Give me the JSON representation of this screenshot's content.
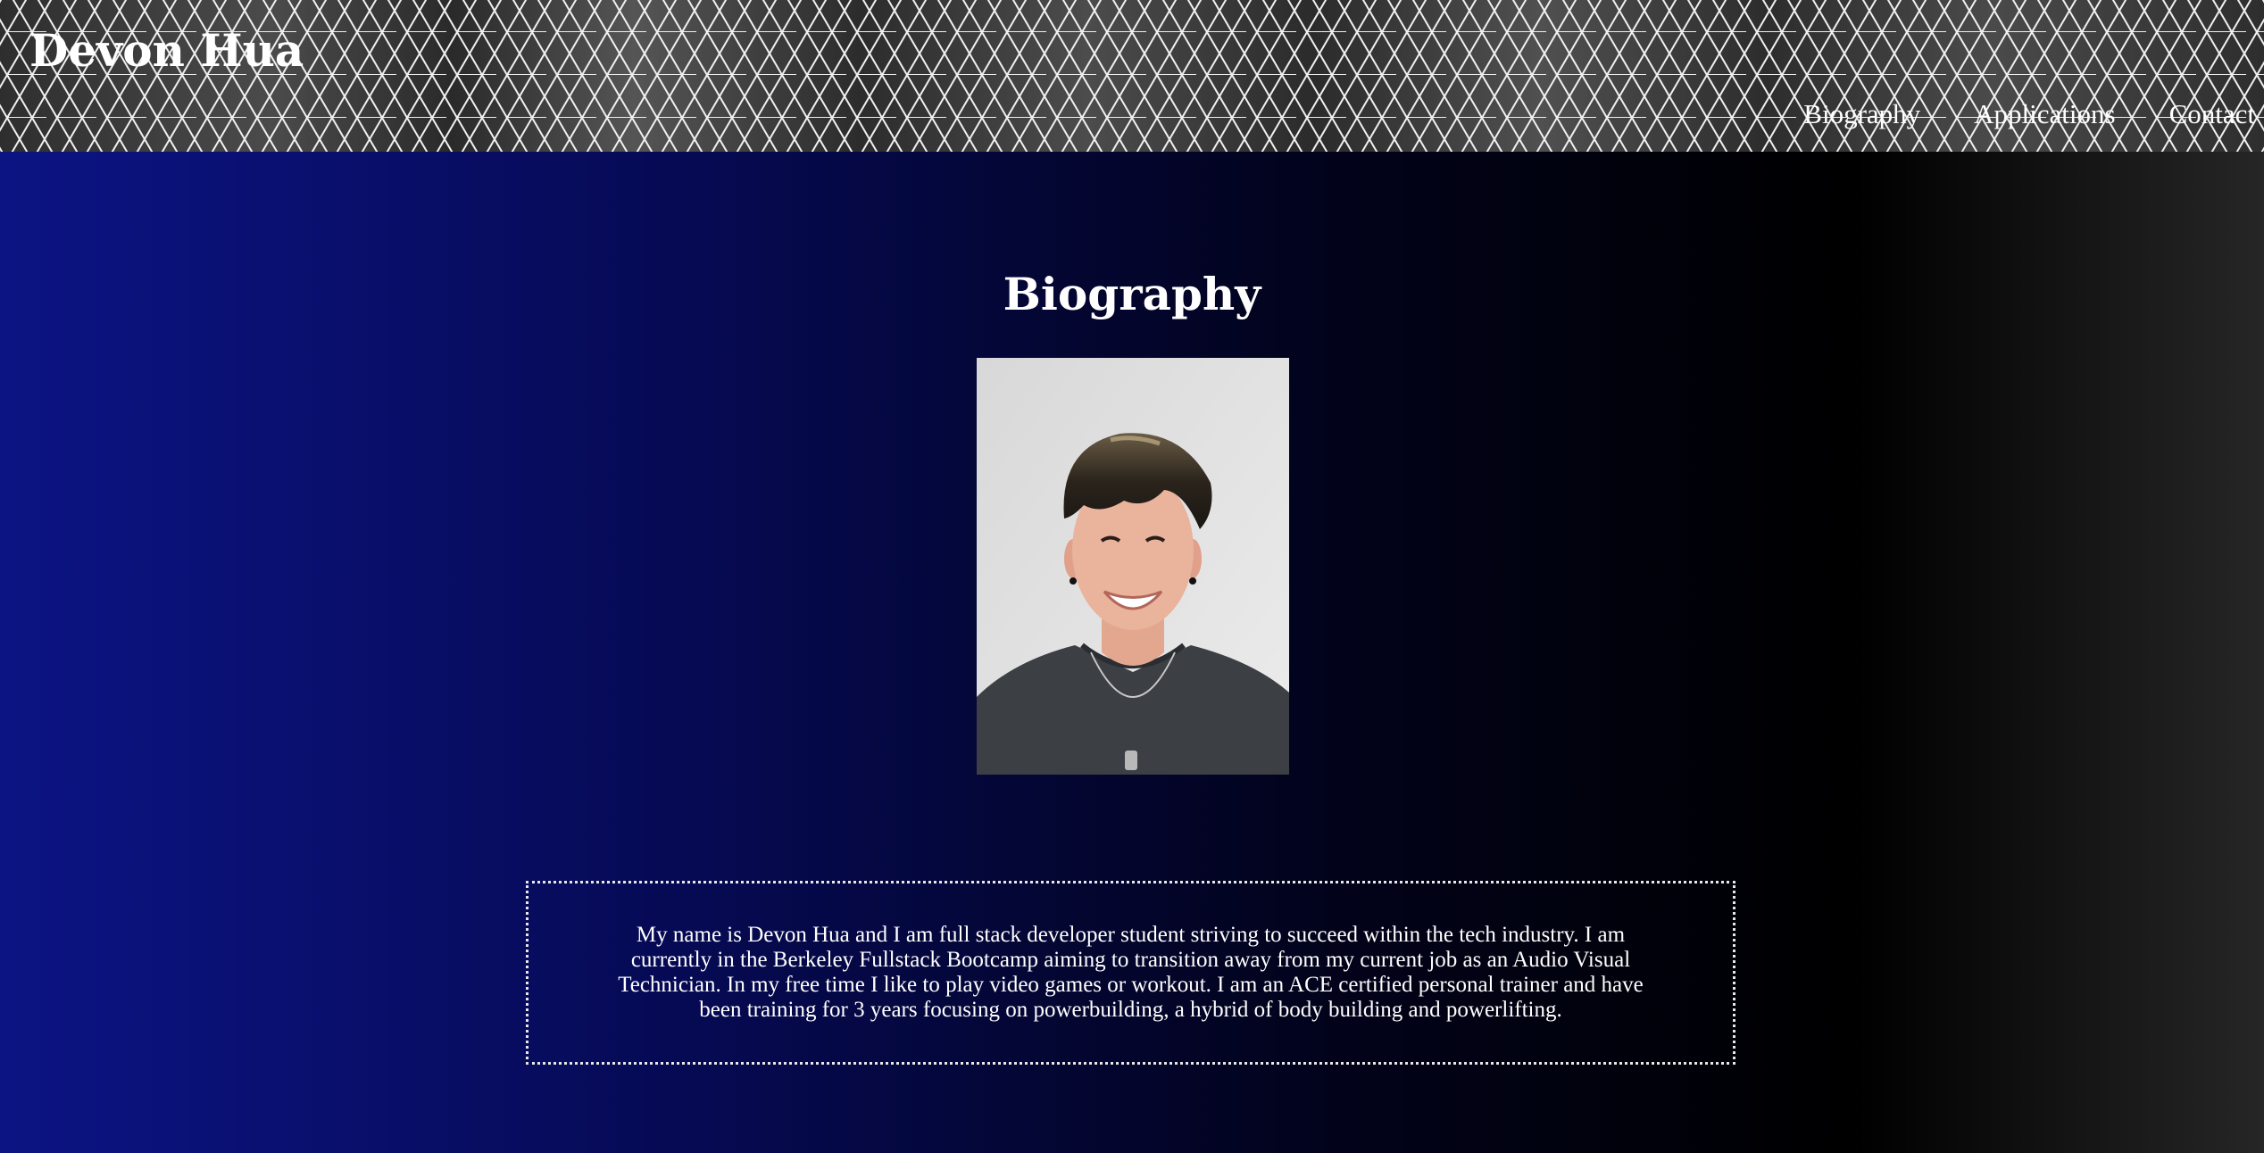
{
  "header": {
    "site_title": "Devon Hua",
    "nav": [
      {
        "label": "Biography"
      },
      {
        "label": "Applications"
      },
      {
        "label": "Contact"
      }
    ]
  },
  "main": {
    "section_title": "Biography",
    "portrait_icon": "person-photo-icon",
    "bio": "My name is Devon Hua and I am full stack developer student striving to succeed within the tech industry. I am currently in the Berkeley Fullstack Bootcamp aiming to transition away from my current job as an Audio Visual Technician. In my free time I like to play video games or workout. I am an ACE certified personal trainer and have been training for 3 years focusing on powerbuilding, a hybrid of body building and powerlifting."
  },
  "colors": {
    "background_left": "#0c1484",
    "background_mid": "#000000",
    "background_right": "#262626",
    "header_pattern_line": "#ffffff",
    "text": "#ffffff"
  }
}
